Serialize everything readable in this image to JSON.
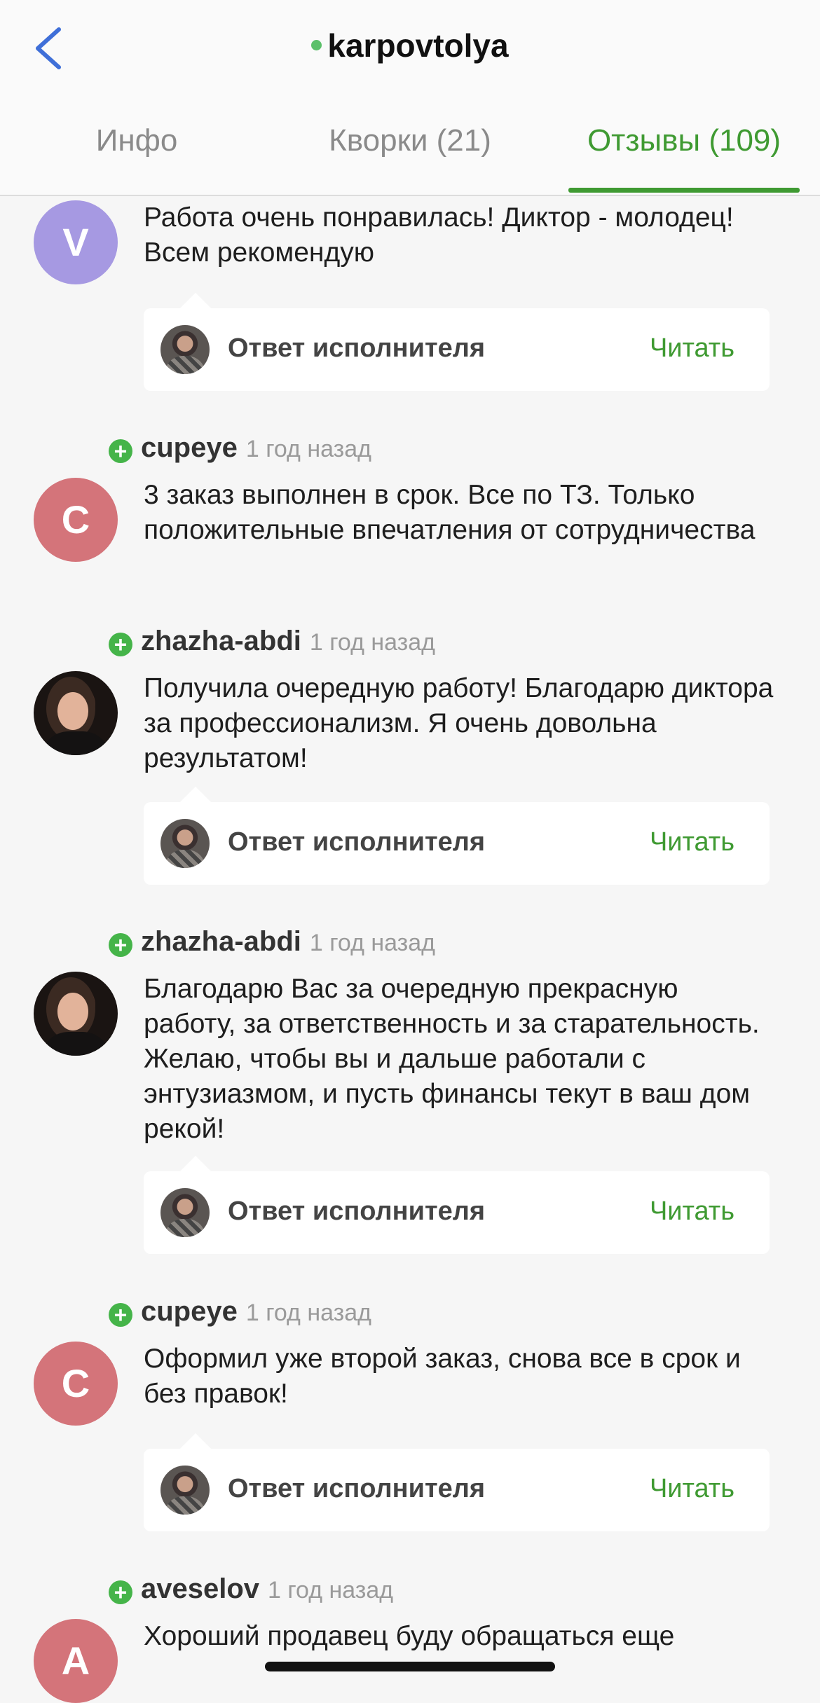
{
  "header": {
    "back_icon": "chevron-left-icon",
    "title": "karpovtolya",
    "online_color": "#5cc06a"
  },
  "tabs": [
    {
      "label": "Инфо",
      "active": false
    },
    {
      "label": "Кворки (21)",
      "active": false
    },
    {
      "label": "Отзывы (109)",
      "active": true
    }
  ],
  "accent_color": "#3f9a32",
  "reviews": [
    {
      "avatar_letter": "V",
      "text": "Работа очень понравилась! Диктор - молодец!  Всем рекомендую",
      "reply": {
        "label": "Ответ исполнителя",
        "action": "Читать"
      }
    },
    {
      "user": "cupeye",
      "time": "1 год назад",
      "avatar_letter": "C",
      "text": "3 заказ выполнен в срок. Все по ТЗ. Только положительные впечатления от сотрудничества"
    },
    {
      "user": "zhazha-abdi",
      "time": "1 год назад",
      "text": "Получила очередную работу! Благодарю диктора за профессионализм. Я очень довольна результатом!",
      "reply": {
        "label": "Ответ исполнителя",
        "action": "Читать"
      }
    },
    {
      "user": "zhazha-abdi",
      "time": "1 год назад",
      "text": "Благодарю Вас за очередную прекрасную работу, за ответственность и  за старательность. Желаю, чтобы вы и дальше работали с энтузиазмом, и пусть финансы текут в ваш дом рекой!",
      "reply": {
        "label": "Ответ исполнителя",
        "action": "Читать"
      }
    },
    {
      "user": "cupeye",
      "time": "1 год назад",
      "avatar_letter": "C",
      "text": "Оформил уже второй заказ, снова все в срок и без правок!",
      "reply": {
        "label": "Ответ исполнителя",
        "action": "Читать"
      }
    },
    {
      "user": "aveselov",
      "time": "1 год назад",
      "avatar_letter": "A",
      "text": "Хороший продавец буду обращаться еще"
    }
  ]
}
